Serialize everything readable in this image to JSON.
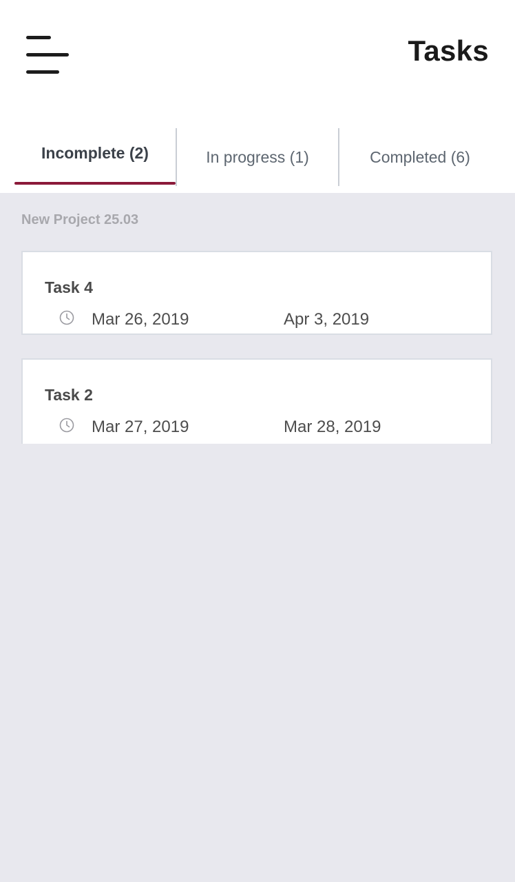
{
  "header": {
    "title": "Tasks",
    "menu_icon": "menu-icon"
  },
  "tabs": [
    {
      "label": "Incomplete (2)",
      "active": true
    },
    {
      "label": "In progress (1)",
      "active": false
    },
    {
      "label": "Completed (6)",
      "active": false
    }
  ],
  "colors": {
    "accent": "#8b1a3a",
    "background": "#e8e8ee"
  },
  "project": {
    "name": "New Project 25.03",
    "tasks": [
      {
        "title": "Task 4",
        "start": "Mar 26, 2019",
        "end": "Apr 3, 2019",
        "icon": "clock-icon"
      },
      {
        "title": "Task 2",
        "start": "Mar 27, 2019",
        "end": "Mar 28, 2019",
        "icon": "clock-icon"
      }
    ]
  }
}
